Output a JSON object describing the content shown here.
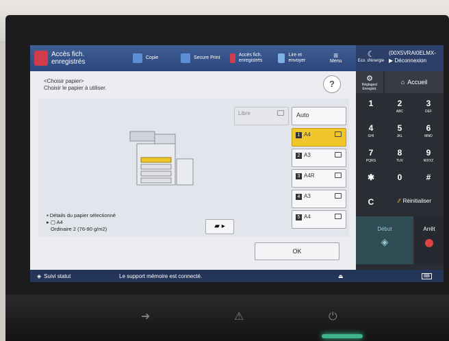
{
  "topbar": {
    "current_app": "Accès fich. enregistrés",
    "apps": [
      {
        "label": "Copie"
      },
      {
        "label": "Secure Print"
      },
      {
        "label": "Accès fich. enregistrés"
      },
      {
        "label": "Lire et envoyer"
      },
      {
        "label": "Menu"
      }
    ],
    "eco_label": "Eco. d'énergie",
    "user": "(00X5VRAI0ELMX-",
    "logout": "Déconnexion"
  },
  "dialog": {
    "breadcrumb": "<Choisir papier>",
    "instruction": "Choisir le papier à utiliser.",
    "help": "?",
    "details_label": "Détails du papier sélectionné",
    "selected_size": "A4",
    "selected_type": "Ordinaire 2 (76-90 g/m2)",
    "auto": "Auto",
    "trays": [
      {
        "num": "",
        "label": "Libre",
        "state": "disabled"
      },
      {
        "num": "1",
        "label": "A4",
        "state": "selected"
      },
      {
        "num": "2",
        "label": "A3",
        "state": "normal"
      },
      {
        "num": "3",
        "label": "A4R",
        "state": "normal"
      },
      {
        "num": "4",
        "label": "A3",
        "state": "normal"
      },
      {
        "num": "5",
        "label": "A4",
        "state": "normal"
      }
    ],
    "ok": "OK"
  },
  "side": {
    "settings": "Réglages/ Enregistr.",
    "home": "Accueil",
    "reset": "Réinitialiser",
    "start": "Début",
    "stop": "Arrêt"
  },
  "keypad": [
    {
      "k": "1",
      "s": ""
    },
    {
      "k": "2",
      "s": "ABC"
    },
    {
      "k": "3",
      "s": "DEF"
    },
    {
      "k": "4",
      "s": "GHI"
    },
    {
      "k": "5",
      "s": "JKL"
    },
    {
      "k": "6",
      "s": "MNO"
    },
    {
      "k": "7",
      "s": "PQRS"
    },
    {
      "k": "8",
      "s": "TUV"
    },
    {
      "k": "9",
      "s": "WXYZ"
    },
    {
      "k": "✱",
      "s": ""
    },
    {
      "k": "0",
      "s": ""
    },
    {
      "k": "#",
      "s": ""
    },
    {
      "k": "C",
      "s": ""
    }
  ],
  "status": {
    "monitor": "Suivi statut",
    "message": "Le support mémoire est connecté."
  },
  "colors": {
    "selected_tray": "#f1c62a",
    "topbar": "#2c467c",
    "stop": "#e04343"
  }
}
